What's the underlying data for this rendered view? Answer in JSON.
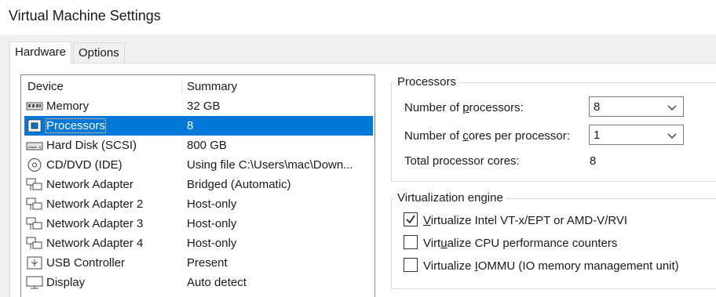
{
  "window": {
    "title": "Virtual Machine Settings"
  },
  "tabs": [
    {
      "label": "Hardware",
      "active": true
    },
    {
      "label": "Options",
      "active": false
    }
  ],
  "device_list": {
    "columns": [
      "Device",
      "Summary"
    ],
    "rows": [
      {
        "icon": "memory-icon",
        "name": "Memory",
        "summary": "32 GB",
        "selected": false
      },
      {
        "icon": "processor-icon",
        "name": "Processors",
        "summary": "8",
        "selected": true
      },
      {
        "icon": "hard-disk-icon",
        "name": "Hard Disk (SCSI)",
        "summary": "800 GB",
        "selected": false
      },
      {
        "icon": "cd-dvd-icon",
        "name": "CD/DVD (IDE)",
        "summary": "Using file C:\\Users\\mac\\Down...",
        "selected": false
      },
      {
        "icon": "network-adapter-icon",
        "name": "Network Adapter",
        "summary": "Bridged (Automatic)",
        "selected": false
      },
      {
        "icon": "network-adapter-icon",
        "name": "Network Adapter 2",
        "summary": "Host-only",
        "selected": false
      },
      {
        "icon": "network-adapter-icon",
        "name": "Network Adapter 3",
        "summary": "Host-only",
        "selected": false
      },
      {
        "icon": "network-adapter-icon",
        "name": "Network Adapter 4",
        "summary": "Host-only",
        "selected": false
      },
      {
        "icon": "usb-controller-icon",
        "name": "USB Controller",
        "summary": "Present",
        "selected": false
      },
      {
        "icon": "display-icon",
        "name": "Display",
        "summary": "Auto detect",
        "selected": false
      }
    ]
  },
  "processors": {
    "group_label": "Processors",
    "num_processors": {
      "label_pre": "Number of ",
      "label_u": "p",
      "label_post": "rocessors:",
      "value": "8"
    },
    "cores_per_processor": {
      "label_pre": "Number of ",
      "label_u": "c",
      "label_post": "ores per processor:",
      "value": "1"
    },
    "total_cores": {
      "label": "Total processor cores:",
      "value": "8"
    }
  },
  "virtualization": {
    "group_label": "Virtualization engine",
    "options": [
      {
        "pre": "",
        "u": "V",
        "post": "irtualize Intel VT-x/EPT or AMD-V/RVI",
        "checked": true
      },
      {
        "pre": "Virt",
        "u": "u",
        "post": "alize CPU performance counters",
        "checked": false
      },
      {
        "pre": "Virtualize ",
        "u": "I",
        "post": "OMMU (IO memory management unit)",
        "checked": false
      }
    ]
  }
}
